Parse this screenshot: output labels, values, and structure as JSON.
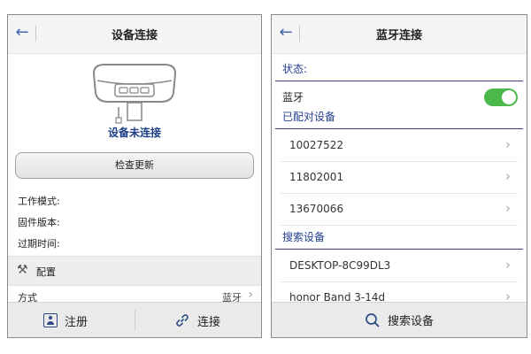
{
  "left": {
    "title": "设备连接",
    "device_status": "设备未连接",
    "check_update_label": "检查更新",
    "info_labels": [
      "工作模式:",
      "固件版本:",
      "过期时间:"
    ],
    "config_label": "配置",
    "mode_label": "方式",
    "mode_value": "蓝牙",
    "register_label": "注册",
    "connect_label": "连接"
  },
  "right": {
    "title": "蓝牙连接",
    "status_head": "状态:",
    "bluetooth_label": "蓝牙",
    "bluetooth_on": true,
    "paired_head": "已配对设备",
    "paired_devices": [
      "10027522",
      "11802001",
      "13670066"
    ],
    "search_head": "搜索设备",
    "found_devices": [
      "DESKTOP-8C99DL3",
      "honor Band 3-14d"
    ],
    "search_button_label": "搜索设备"
  },
  "colors": {
    "accent_blue": "#25408f",
    "toggle_green": "#4cb84c"
  },
  "icons": {
    "back": "arrow-left-icon",
    "config": "tools-icon",
    "register": "id-card-icon",
    "connect": "link-icon",
    "search": "magnifier-icon",
    "chevron": "chevron-right-icon"
  }
}
